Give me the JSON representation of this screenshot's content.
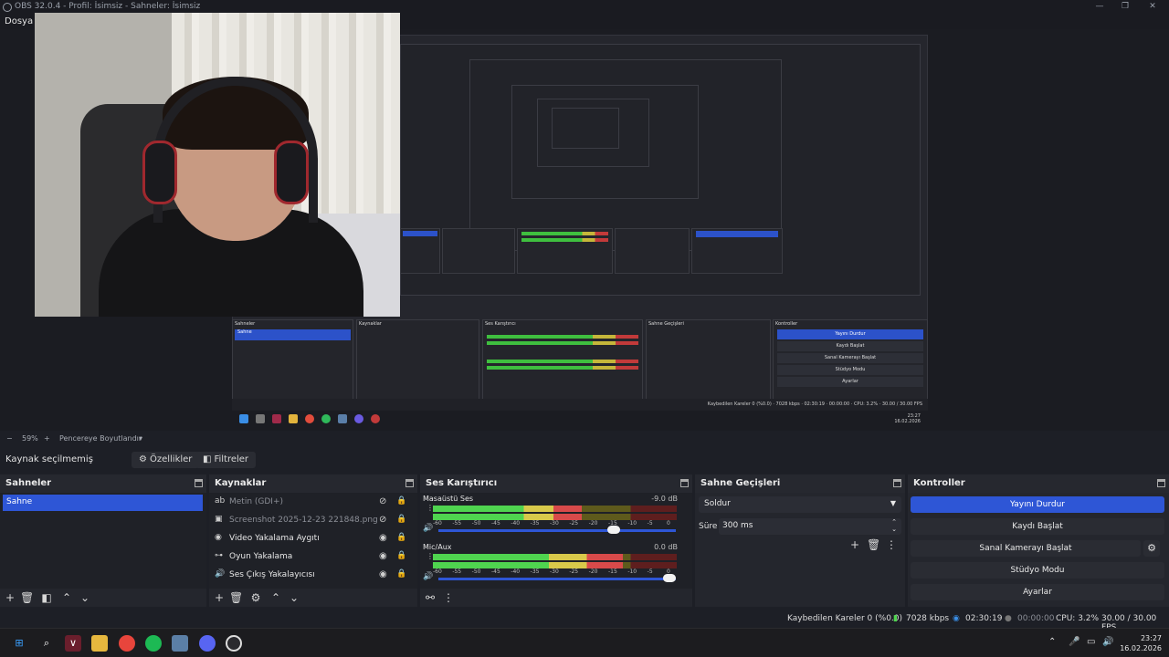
{
  "window": {
    "title": "OBS 32.0.4 - Profil: İsimsiz - Sahneler: İsimsiz"
  },
  "menu": {
    "file": "Dosya"
  },
  "zoom": {
    "minus": "−",
    "value": "59%",
    "plus": "+",
    "fit_label": "Pencereye Boyutlandır"
  },
  "source_bar": {
    "no_selection": "Kaynak seçilmemiş",
    "properties": "Özellikler",
    "filters": "Filtreler"
  },
  "scenes": {
    "title": "Sahneler",
    "items": [
      "Sahne"
    ]
  },
  "sources": {
    "title": "Kaynaklar",
    "items": [
      {
        "label": "Metin (GDI+)",
        "icon": "text-icon",
        "visible": false
      },
      {
        "label": "Screenshot 2025-12-23 221848.png",
        "icon": "image-icon",
        "visible": false
      },
      {
        "label": "Video Yakalama Aygıtı",
        "icon": "camera-icon",
        "visible": true
      },
      {
        "label": "Oyun Yakalama",
        "icon": "gamepad-icon",
        "visible": true
      },
      {
        "label": "Ses Çıkış Yakalayıcısı",
        "icon": "speaker-icon",
        "visible": true
      }
    ]
  },
  "mixer": {
    "title": "Ses Karıştırıcı",
    "channels": [
      {
        "name": "Masaüstü Ses",
        "db": "-9.0 dB",
        "level": 0.61,
        "volume": 0.75
      },
      {
        "name": "Mic/Aux",
        "db": "0.0 dB",
        "level": 0.78,
        "volume": 1.0
      }
    ],
    "scale": [
      "-60",
      "-55",
      "-50",
      "-45",
      "-40",
      "-35",
      "-30",
      "-25",
      "-20",
      "-15",
      "-10",
      "-5",
      "0"
    ]
  },
  "transitions": {
    "title": "Sahne Geçişleri",
    "selected": "Soldur",
    "duration_label": "Süre",
    "duration_value": "300 ms"
  },
  "controls": {
    "title": "Kontroller",
    "stop_stream": "Yayını Durdur",
    "start_recording": "Kaydı Başlat",
    "start_virtualcam": "Sanal Kamerayı Başlat",
    "studio_mode": "Stüdyo Modu",
    "settings": "Ayarlar"
  },
  "status": {
    "dropped_frames": "Kaybedilen Kareler 0 (%0.0)",
    "bitrate": "7028 kbps",
    "stream_time": "02:30:19",
    "record_time": "00:00:00",
    "cpu": "CPU: 3.2%",
    "fps": "30.00 / 30.00 FPS"
  },
  "taskbar": {
    "time": "23:27",
    "date": "16.02.2026"
  },
  "colors": {
    "accent": "#2e56d6",
    "bg": "#1d1f26",
    "panel": "#24262d"
  }
}
